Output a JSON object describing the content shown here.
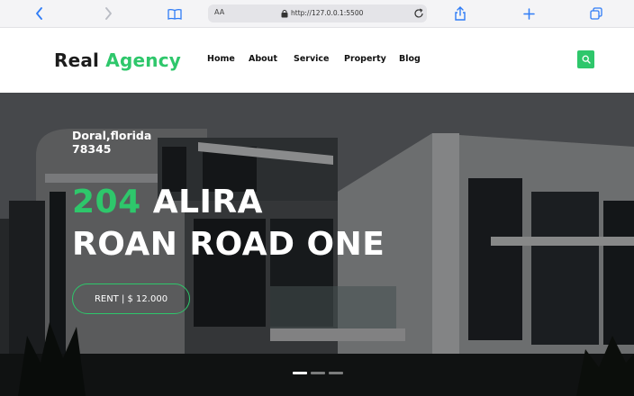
{
  "browser": {
    "text_size_label": "AA",
    "url": "http://127.0.0.1:5500",
    "icons": [
      "back-icon",
      "forward-icon",
      "book-icon",
      "lock-icon",
      "reload-icon",
      "share-icon",
      "plus-icon",
      "tabs-icon"
    ]
  },
  "header": {
    "logo_main": "Real",
    "logo_accent": "Agency",
    "nav": [
      "Home",
      "About",
      "Service",
      "Property",
      "Blog"
    ],
    "search_icon": "search-icon"
  },
  "hero": {
    "location_line1": "Doral,florida",
    "location_line2": "78345",
    "title_number": "204",
    "title_rest_line1": "ALIRA",
    "title_line2": "ROAN ROAD ONE",
    "rent_label": "RENT | $ 12.000",
    "slide_count": 3,
    "active_slide": 1
  },
  "colors": {
    "accent": "#2ec76b",
    "browser_blue": "#2f7cf6",
    "hero_text": "#ffffff"
  }
}
